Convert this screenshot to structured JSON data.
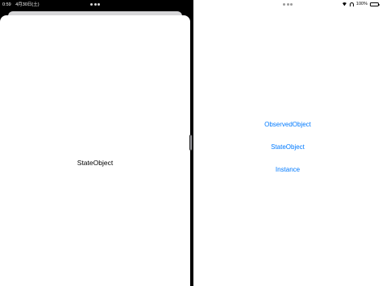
{
  "left_pane": {
    "status_bar": {
      "time": "0:59",
      "date": "4月30日(土)"
    },
    "sheet": {
      "title": "StateObject"
    }
  },
  "right_pane": {
    "status_bar": {
      "battery_percent": "100%",
      "battery_level": 1.0,
      "icons": [
        "wifi-icon",
        "headphones-icon",
        "battery-icon"
      ]
    },
    "buttons": [
      {
        "label": "ObservedObject"
      },
      {
        "label": "StateObject"
      },
      {
        "label": "Instance"
      }
    ]
  },
  "colors": {
    "accent": "#007aff",
    "backdrop": "#000000",
    "sheet": "#ffffff"
  }
}
